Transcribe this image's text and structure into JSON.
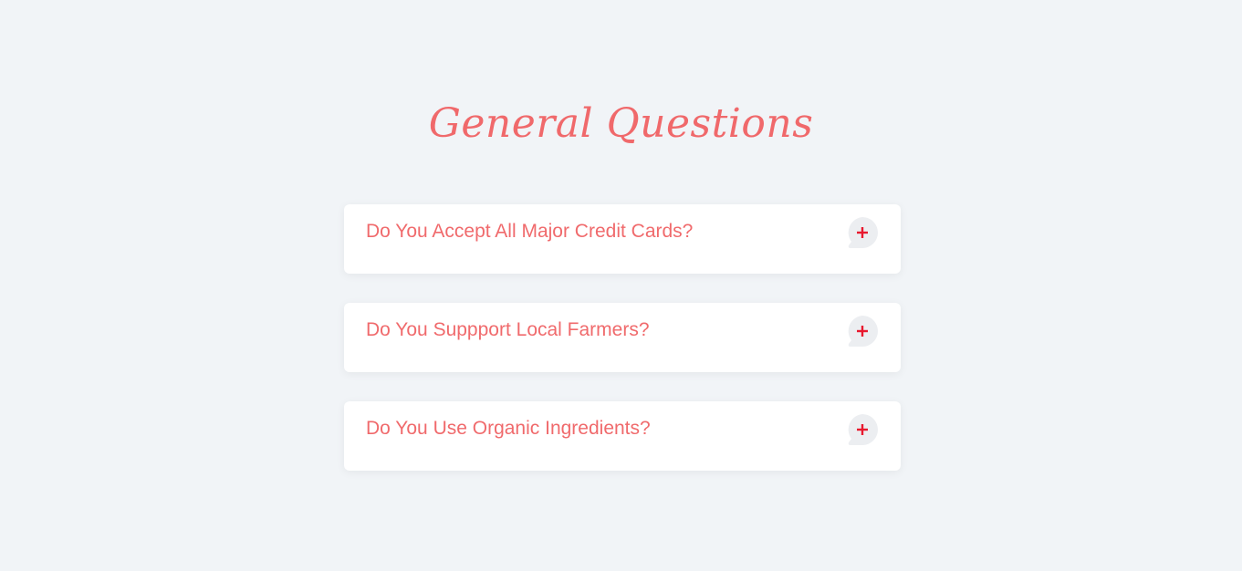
{
  "faq": {
    "title": "General Questions",
    "items": [
      {
        "question": "Do You Accept All Major Credit Cards?",
        "icon": "plus-icon"
      },
      {
        "question": "Do You Suppport Local Farmers?",
        "icon": "plus-icon"
      },
      {
        "question": "Do You Use Organic Ingredients?",
        "icon": "plus-icon"
      }
    ]
  },
  "colors": {
    "accent": "#f0696b",
    "plus": "#e8182e",
    "bubble": "#eceef1",
    "background": "#f1f4f7",
    "card": "#ffffff"
  }
}
